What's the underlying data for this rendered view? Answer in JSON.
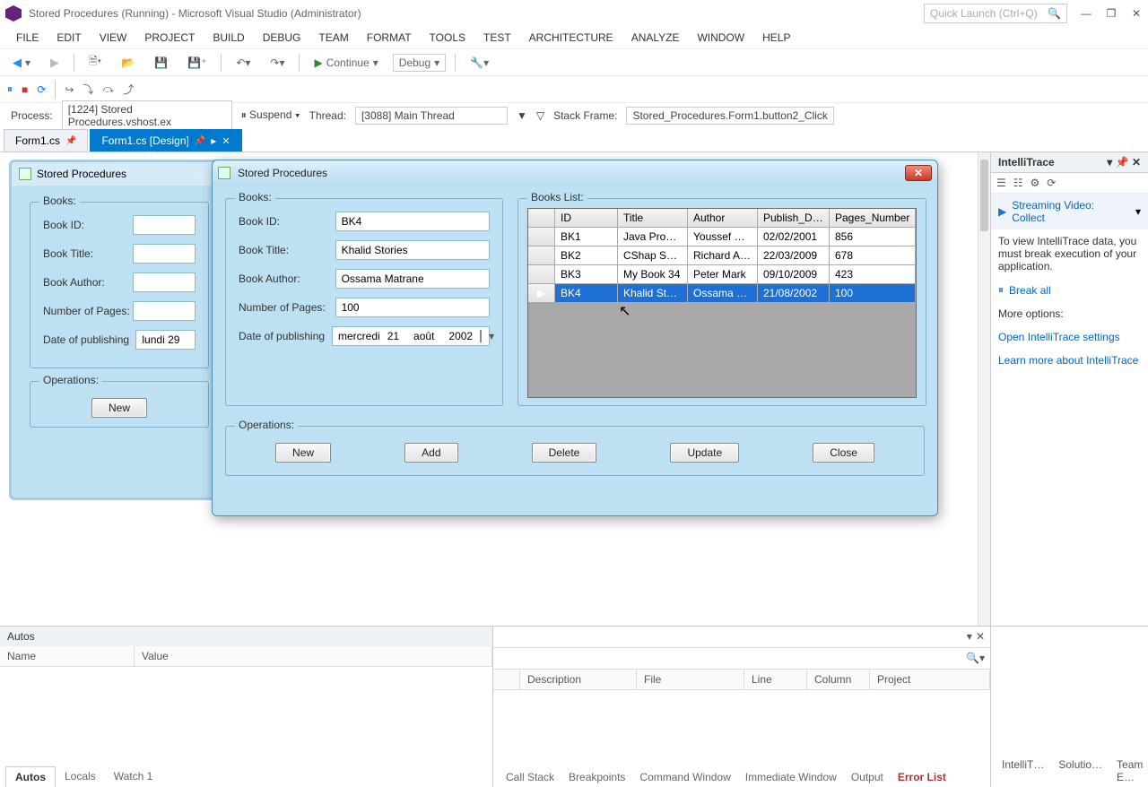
{
  "titlebar": {
    "title": "Stored Procedures (Running) - Microsoft Visual Studio (Administrator)",
    "quicklaunch_placeholder": "Quick Launch (Ctrl+Q)"
  },
  "menu": [
    "FILE",
    "EDIT",
    "VIEW",
    "PROJECT",
    "BUILD",
    "DEBUG",
    "TEAM",
    "FORMAT",
    "TOOLS",
    "TEST",
    "ARCHITECTURE",
    "ANALYZE",
    "WINDOW",
    "HELP"
  ],
  "toolbar": {
    "continue": "Continue",
    "config": "Debug"
  },
  "process": {
    "label": "Process:",
    "value": "[1224] Stored Procedures.vshost.ex",
    "suspend": "Suspend",
    "thread_label": "Thread:",
    "thread_value": "[3088] Main Thread",
    "stack_label": "Stack Frame:",
    "stack_value": "Stored_Procedures.Form1.button2_Click"
  },
  "tabs": [
    {
      "label": "Form1.cs",
      "active": false
    },
    {
      "label": "Form1.cs [Design]",
      "active": true
    }
  ],
  "intellitrace": {
    "title": "IntelliTrace",
    "stream": "Streaming Video: Collect",
    "msg": "To view IntelliTrace data, you must break execution of your application.",
    "break": "Break all",
    "more": "More options:",
    "open": "Open IntelliTrace settings",
    "learn": "Learn more about IntelliTrace"
  },
  "designer_form": {
    "title": "Stored Procedures",
    "books_legend": "Books:",
    "labels": {
      "id": "Book ID:",
      "title": "Book Title:",
      "author": "Book Author:",
      "pages": "Number of Pages:",
      "date": "Date of publishing"
    },
    "date_value": "lundi     29",
    "ops_legend": "Operations:",
    "new_btn": "New"
  },
  "runtime_form": {
    "title": "Stored Procedures",
    "books_legend": "Books:",
    "list_legend": "Books List:",
    "labels": {
      "id": "Book ID:",
      "title": "Book Title:",
      "author": "Book Author:",
      "pages": "Number of Pages:",
      "date": "Date of publishing"
    },
    "values": {
      "id": "BK4",
      "title": "Khalid Stories",
      "author": "Ossama Matrane",
      "pages": "100"
    },
    "date": {
      "weekday": "mercredi",
      "day": "21",
      "month": "août",
      "year": "2002"
    },
    "ops_legend": "Operations:",
    "buttons": {
      "new": "New",
      "add": "Add",
      "delete": "Delete",
      "update": "Update",
      "close": "Close"
    },
    "columns": [
      "ID",
      "Title",
      "Author",
      "Publish_Date",
      "Pages_Number"
    ],
    "rows": [
      {
        "id": "BK1",
        "title": "Java Progra…",
        "author": "Youssef Ro…",
        "date": "02/02/2001",
        "pages": "856"
      },
      {
        "id": "BK2",
        "title": "CShap Spec…",
        "author": "Richard Alex",
        "date": "22/03/2009",
        "pages": "678"
      },
      {
        "id": "BK3",
        "title": "My Book 34",
        "author": "Peter Mark",
        "date": "09/10/2009",
        "pages": "423"
      },
      {
        "id": "BK4",
        "title": "Khalid Stories",
        "author": "Ossama Ma…",
        "date": "21/08/2002",
        "pages": "100"
      }
    ],
    "selected_index": 3
  },
  "autos": {
    "title": "Autos",
    "col_name": "Name",
    "col_value": "Value",
    "tabs": [
      "Autos",
      "Locals",
      "Watch 1"
    ]
  },
  "rb": {
    "cols": [
      "Description",
      "File",
      "Line",
      "Column",
      "Project"
    ],
    "tabs": [
      "Call Stack",
      "Breakpoints",
      "Command Window",
      "Immediate Window",
      "Output",
      "Error List"
    ]
  },
  "far_right_tabs": [
    "IntelliT…",
    "Solutio…",
    "Team E…"
  ]
}
